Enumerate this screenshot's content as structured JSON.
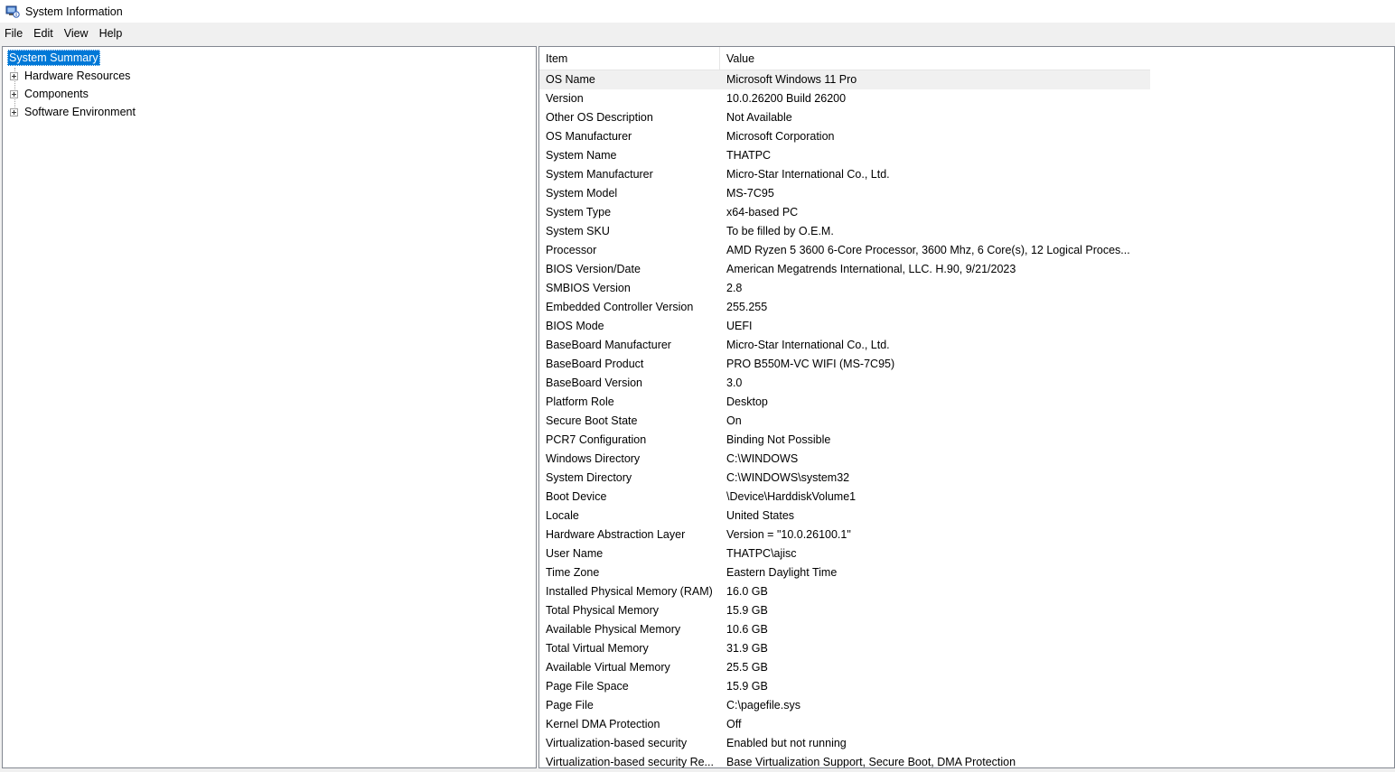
{
  "window": {
    "title": "System Information",
    "icon": "system-information-icon"
  },
  "menu": [
    "File",
    "Edit",
    "View",
    "Help"
  ],
  "tree": {
    "root": "System Summary",
    "children": [
      "Hardware Resources",
      "Components",
      "Software Environment"
    ]
  },
  "table": {
    "headers": {
      "item": "Item",
      "value": "Value"
    },
    "rows": [
      {
        "item": "OS Name",
        "value": "Microsoft Windows 11 Pro"
      },
      {
        "item": "Version",
        "value": "10.0.26200 Build 26200"
      },
      {
        "item": "Other OS Description",
        "value": "Not Available"
      },
      {
        "item": "OS Manufacturer",
        "value": "Microsoft Corporation"
      },
      {
        "item": "System Name",
        "value": "THATPC"
      },
      {
        "item": "System Manufacturer",
        "value": "Micro-Star International Co., Ltd."
      },
      {
        "item": "System Model",
        "value": "MS-7C95"
      },
      {
        "item": "System Type",
        "value": "x64-based PC"
      },
      {
        "item": "System SKU",
        "value": "To be filled by O.E.M."
      },
      {
        "item": "Processor",
        "value": "AMD Ryzen 5 3600 6-Core Processor, 3600 Mhz, 6 Core(s), 12 Logical Proces..."
      },
      {
        "item": "BIOS Version/Date",
        "value": "American Megatrends International, LLC. H.90, 9/21/2023"
      },
      {
        "item": "SMBIOS Version",
        "value": "2.8"
      },
      {
        "item": "Embedded Controller Version",
        "value": "255.255"
      },
      {
        "item": "BIOS Mode",
        "value": "UEFI"
      },
      {
        "item": "BaseBoard Manufacturer",
        "value": "Micro-Star International Co., Ltd."
      },
      {
        "item": "BaseBoard Product",
        "value": "PRO B550M-VC WIFI (MS-7C95)"
      },
      {
        "item": "BaseBoard Version",
        "value": "3.0"
      },
      {
        "item": "Platform Role",
        "value": "Desktop"
      },
      {
        "item": "Secure Boot State",
        "value": "On"
      },
      {
        "item": "PCR7 Configuration",
        "value": "Binding Not Possible"
      },
      {
        "item": "Windows Directory",
        "value": "C:\\WINDOWS"
      },
      {
        "item": "System Directory",
        "value": "C:\\WINDOWS\\system32"
      },
      {
        "item": "Boot Device",
        "value": "\\Device\\HarddiskVolume1"
      },
      {
        "item": "Locale",
        "value": "United States"
      },
      {
        "item": "Hardware Abstraction Layer",
        "value": "Version = \"10.0.26100.1\""
      },
      {
        "item": "User Name",
        "value": "THATPC\\ajisc"
      },
      {
        "item": "Time Zone",
        "value": "Eastern Daylight Time"
      },
      {
        "item": "Installed Physical Memory (RAM)",
        "value": "16.0 GB"
      },
      {
        "item": "Total Physical Memory",
        "value": "15.9 GB"
      },
      {
        "item": "Available Physical Memory",
        "value": "10.6 GB"
      },
      {
        "item": "Total Virtual Memory",
        "value": "31.9 GB"
      },
      {
        "item": "Available Virtual Memory",
        "value": "25.5 GB"
      },
      {
        "item": "Page File Space",
        "value": "15.9 GB"
      },
      {
        "item": "Page File",
        "value": "C:\\pagefile.sys"
      },
      {
        "item": "Kernel DMA Protection",
        "value": "Off"
      },
      {
        "item": "Virtualization-based security",
        "value": "Enabled but not running"
      },
      {
        "item": "Virtualization-based security Re...",
        "value": "Base Virtualization Support, Secure Boot, DMA Protection"
      }
    ]
  },
  "colors": {
    "selection": "#0078d7",
    "row_highlight": "#f0f0f0",
    "border": "#828790"
  }
}
